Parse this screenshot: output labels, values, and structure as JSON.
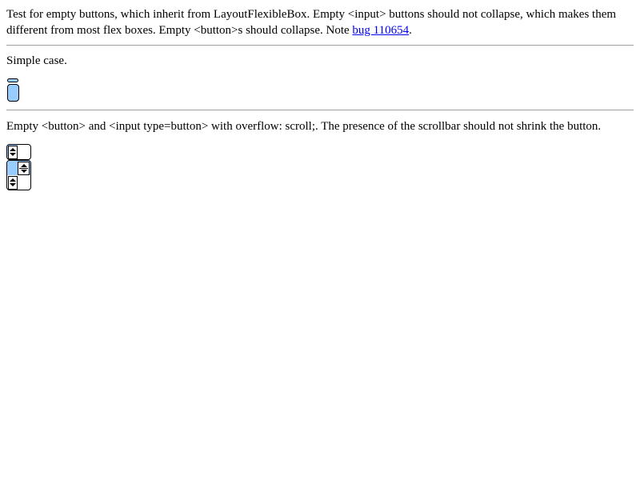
{
  "intro": {
    "text_part1": "Test for empty buttons, which inherit from LayoutFlexibleBox. Empty <input> buttons should not collapse, which makes them different from most flex boxes. Empty <button>s should collapse. Note ",
    "link_text": "bug 110654",
    "text_end": "."
  },
  "simple_case": {
    "text": "Simple case."
  },
  "scroll_case": {
    "text": "Empty <button> and <input type=button> with overflow: scroll;. The presence of the scrollbar should not shrink the button."
  },
  "colors": {
    "button_fill": "#99ccff",
    "link": "#0000ee",
    "rule": "#a0a0a0"
  },
  "icons": {
    "scroll_up": "arrow-up",
    "scroll_down": "arrow-down"
  }
}
